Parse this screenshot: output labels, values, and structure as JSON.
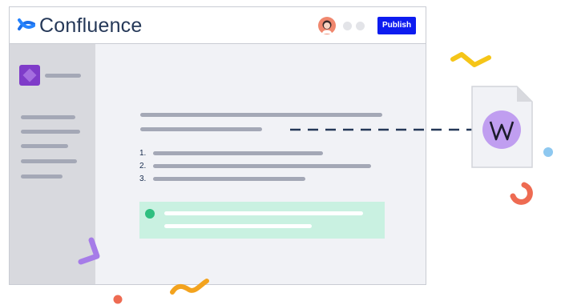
{
  "header": {
    "app_name": "Confluence",
    "publish_label": "Publish"
  },
  "content": {
    "list_numbers": [
      "1.",
      "2.",
      "3."
    ]
  },
  "colors": {
    "brand_blue": "#0d1cf0",
    "space_purple": "#7f3cc9",
    "callout_green": "#c9f1e1",
    "wordpress_purple": "#c09ef0"
  },
  "icons": [
    "confluence-logo-icon",
    "user-avatar-icon",
    "space-icon",
    "status-dot-icon",
    "wordpress-logo-icon",
    "document-file-icon"
  ]
}
